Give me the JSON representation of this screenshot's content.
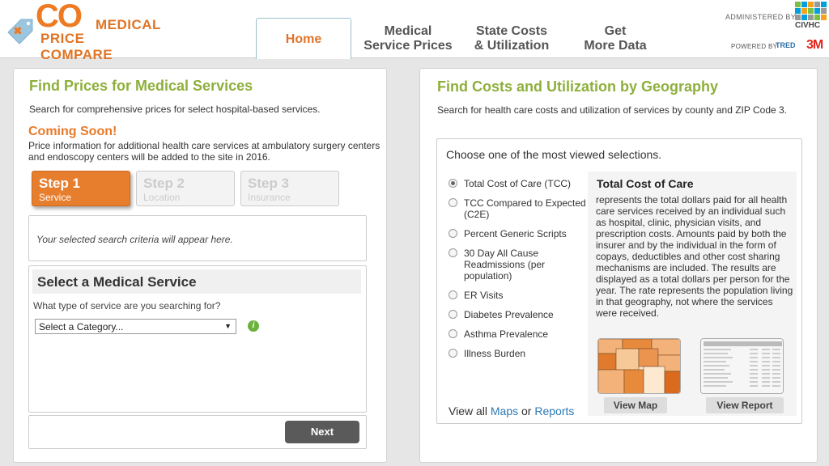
{
  "brand": {
    "logo_co": "CO",
    "logo_line1": "MEDICAL",
    "logo_line2": "PRICE COMPARE",
    "administered_label": "ADMINISTERED BY",
    "civhc_name": "CIVHC",
    "powered_label": "POWERED BY",
    "tred": "TRED",
    "threem": "3M",
    "colors": {
      "orange": "#ee7a22",
      "green": "#8eaf3c",
      "link": "#2c79b5"
    }
  },
  "nav": {
    "tabs": [
      {
        "line1": "Home",
        "line2": ""
      },
      {
        "line1": "Medical",
        "line2": "Service Prices"
      },
      {
        "line1": "State Costs",
        "line2": "& Utilization"
      },
      {
        "line1": "Get",
        "line2": "More Data"
      }
    ]
  },
  "left": {
    "title": "Find Prices for Medical Services",
    "description": "Search for comprehensive prices for select hospital-based services.",
    "coming_soon_title": "Coming Soon!",
    "coming_soon_text": "Price information for additional health care services at ambulatory surgery centers and endoscopy centers will be added to the site in 2016.",
    "steps": [
      {
        "number": "Step 1",
        "label": "Service"
      },
      {
        "number": "Step 2",
        "label": "Location"
      },
      {
        "number": "Step 3",
        "label": "Insurance"
      }
    ],
    "criteria_placeholder": "Your selected search criteria will appear here.",
    "service_heading": "Select a Medical Service",
    "service_question": "What type of service are you searching for?",
    "select_value": "Select a Category...",
    "help_icon": "i",
    "next_label": "Next"
  },
  "right": {
    "title": "Find Costs and Utilization by Geography",
    "description": "Search for health care costs and utilization of services by county and ZIP Code 3.",
    "choose_label": "Choose one of the most viewed selections.",
    "options": [
      "Total Cost of Care (TCC)",
      "TCC Compared to Expected (C2E)",
      "Percent Generic Scripts",
      "30 Day All Cause Readmissions (per population)",
      "ER Visits",
      "Diabetes Prevalence",
      "Asthma Prevalence",
      "Illness Burden"
    ],
    "selected_option": "Total Cost of Care (TCC)",
    "detail_title": "Total Cost of Care",
    "detail_text": "represents the total dollars paid for all health care services received by an individual such as hospital, clinic, physician visits, and prescription costs. Amounts paid by both the insurer and by the individual in the form of copays, deductibles and other cost sharing mechanisms are included. The results are displayed as a total dollars per person for the year. The rate represents the population living in that geography, not where the services were received.",
    "view_map_label": "View Map",
    "view_report_label": "View Report",
    "view_all_prefix": "View all",
    "maps_link": "Maps",
    "or_text": "or",
    "reports_link": "Reports"
  }
}
